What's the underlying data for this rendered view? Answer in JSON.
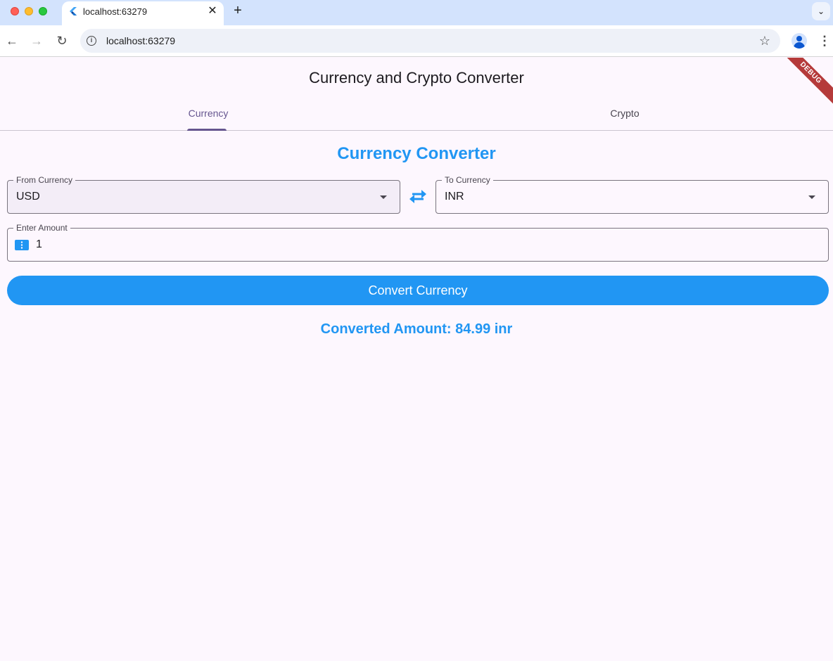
{
  "browser": {
    "tab_title": "localhost:63279",
    "tab_close": "✕",
    "new_tab": "+",
    "tabs_dropdown": "⌄",
    "url": "localhost:63279",
    "info_glyph": "i",
    "star_glyph": "☆",
    "menu_glyph": "⋮",
    "back_glyph": "←",
    "forward_glyph": "→",
    "reload_glyph": "↻"
  },
  "app": {
    "title": "Currency and Crypto Converter",
    "debug_banner": "DEBUG",
    "tabs": [
      {
        "label": "Currency",
        "selected": true
      },
      {
        "label": "Crypto",
        "selected": false
      }
    ],
    "section_title": "Currency Converter",
    "from_currency": {
      "label": "From Currency",
      "value": "USD"
    },
    "to_currency": {
      "label": "To Currency",
      "value": "INR"
    },
    "amount": {
      "label": "Enter Amount",
      "value": "1"
    },
    "convert_button": "Convert Currency",
    "result": "Converted Amount: 84.99 inr",
    "icons": {
      "swap": "swap-horiz-icon",
      "amount": "money-icon"
    }
  },
  "colors": {
    "accent": "#2196f3",
    "tab_selected": "#65558f",
    "debug": "#b53a3a",
    "background": "#fdf7fe"
  }
}
